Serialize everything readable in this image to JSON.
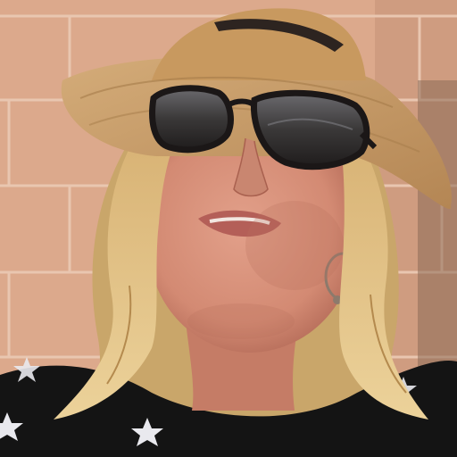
{
  "scene": {
    "palette": {
      "wall": "#dca98c",
      "wall_shade": "#c98f73",
      "mortar": "#e8c3ad",
      "hat_straw": "#c69a66",
      "hat_band": "#2d2420",
      "hair": "#e1c184",
      "hair_dark": "#b48a4e",
      "skin": "#d9917a",
      "skin_shadow": "#b9715d",
      "lens": "#3b3838",
      "frame": "#1b1717",
      "lips": "#b45f58",
      "shirt": "#141414",
      "star": "#e9e9ee",
      "earring": "#8c7a6c"
    },
    "elements": [
      "brick-wall",
      "straw-hat",
      "sunglasses",
      "hoop-earrings",
      "blonde-hair",
      "star-print-shirt"
    ]
  }
}
